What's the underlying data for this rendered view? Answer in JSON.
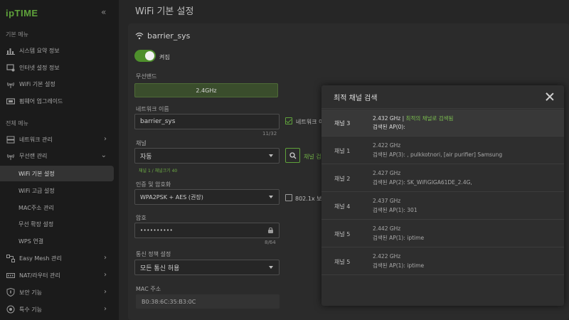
{
  "sidebar": {
    "logo": "ipTIME",
    "collapse_icon": "double-chevron-left",
    "basic_menu_title": "기본 메뉴",
    "basic_items": [
      {
        "label": "시스템 요약 정보",
        "icon": "bar-chart-icon"
      },
      {
        "label": "인터넷 설정 정보",
        "icon": "internet-settings-icon"
      },
      {
        "label": "WiFi 기본 설정",
        "icon": "wifi-antenna-icon"
      },
      {
        "label": "펌웨어 업그레이드",
        "icon": "firmware-icon"
      }
    ],
    "all_menu_title": "전체 메뉴",
    "all_items": [
      {
        "label": "네트워크 관리",
        "icon": "network-icon"
      },
      {
        "label": "무선랜 관리",
        "icon": "wifi-antenna-icon"
      }
    ],
    "sub_items": [
      "WiFi 기본 설정",
      "WiFi 고급 설정",
      "MAC주소 관리",
      "무선 확장 설정",
      "WPS 연결"
    ],
    "bottom_items": [
      {
        "label": "Easy Mesh 관리",
        "icon": "mesh-icon"
      },
      {
        "label": "NAT/라우터 관리",
        "icon": "router-icon"
      },
      {
        "label": "보안 기능",
        "icon": "shield-icon"
      },
      {
        "label": "특수 기능",
        "icon": "special-icon"
      }
    ]
  },
  "main": {
    "title": "WiFi 기본 설정",
    "ssid": "barrier_sys",
    "toggle_label": "켜짐",
    "band_label": "무선밴드",
    "band_value": "2.4GHz",
    "network_name_label": "네트워크 이름",
    "network_name_value": "barrier_sys",
    "network_name_count": "11/32",
    "hide_network_label": "네트워크 이",
    "channel_label": "채널",
    "channel_value": "자동",
    "channel_note": "채널 1 / 채널크기 40",
    "channel_search_label": "채널 검",
    "auth_label": "인증 및 암호화",
    "auth_value": "WPA2PSK + AES (권장)",
    "dot1x_label": "802.1x 보",
    "password_label": "암호",
    "password_value": "••••••••••",
    "password_count": "8/64",
    "policy_label": "통신 정책 설정",
    "policy_value": "모든 통신 허용",
    "mac_label": "MAC 주소",
    "mac_value": "B0:38:6C:35:B3:0C"
  },
  "modal": {
    "title": "최적 채널 검색",
    "rows": [
      {
        "channel": "채널 3",
        "freq": "2.432 GHz",
        "best": "최적의 채널로 검색됨",
        "sep": " | ",
        "ap": "검색된 AP(0):"
      },
      {
        "channel": "채널 1",
        "freq": "2.422 GHz",
        "best": "",
        "sep": "",
        "ap": "검색된 AP(3): , pulkkotnori, [air purifier] Samsung"
      },
      {
        "channel": "채널 2",
        "freq": "2.427 GHz",
        "best": "",
        "sep": "",
        "ap": "검색된 AP(2): SK_WiFiGIGA61DE_2.4G,"
      },
      {
        "channel": "채널 4",
        "freq": "2.437 GHz",
        "best": "",
        "sep": "",
        "ap": "검색된 AP(1): 301"
      },
      {
        "channel": "채널 5",
        "freq": "2.442 GHz",
        "best": "",
        "sep": "",
        "ap": "검색된 AP(1): iptime"
      },
      {
        "channel": "채널 5",
        "freq": "2.422 GHz",
        "best": "",
        "sep": "",
        "ap": "검색된 AP(1): iptime"
      }
    ]
  },
  "colors": {
    "accent": "#5fa23b",
    "best_channel": "#7bbf4f"
  }
}
